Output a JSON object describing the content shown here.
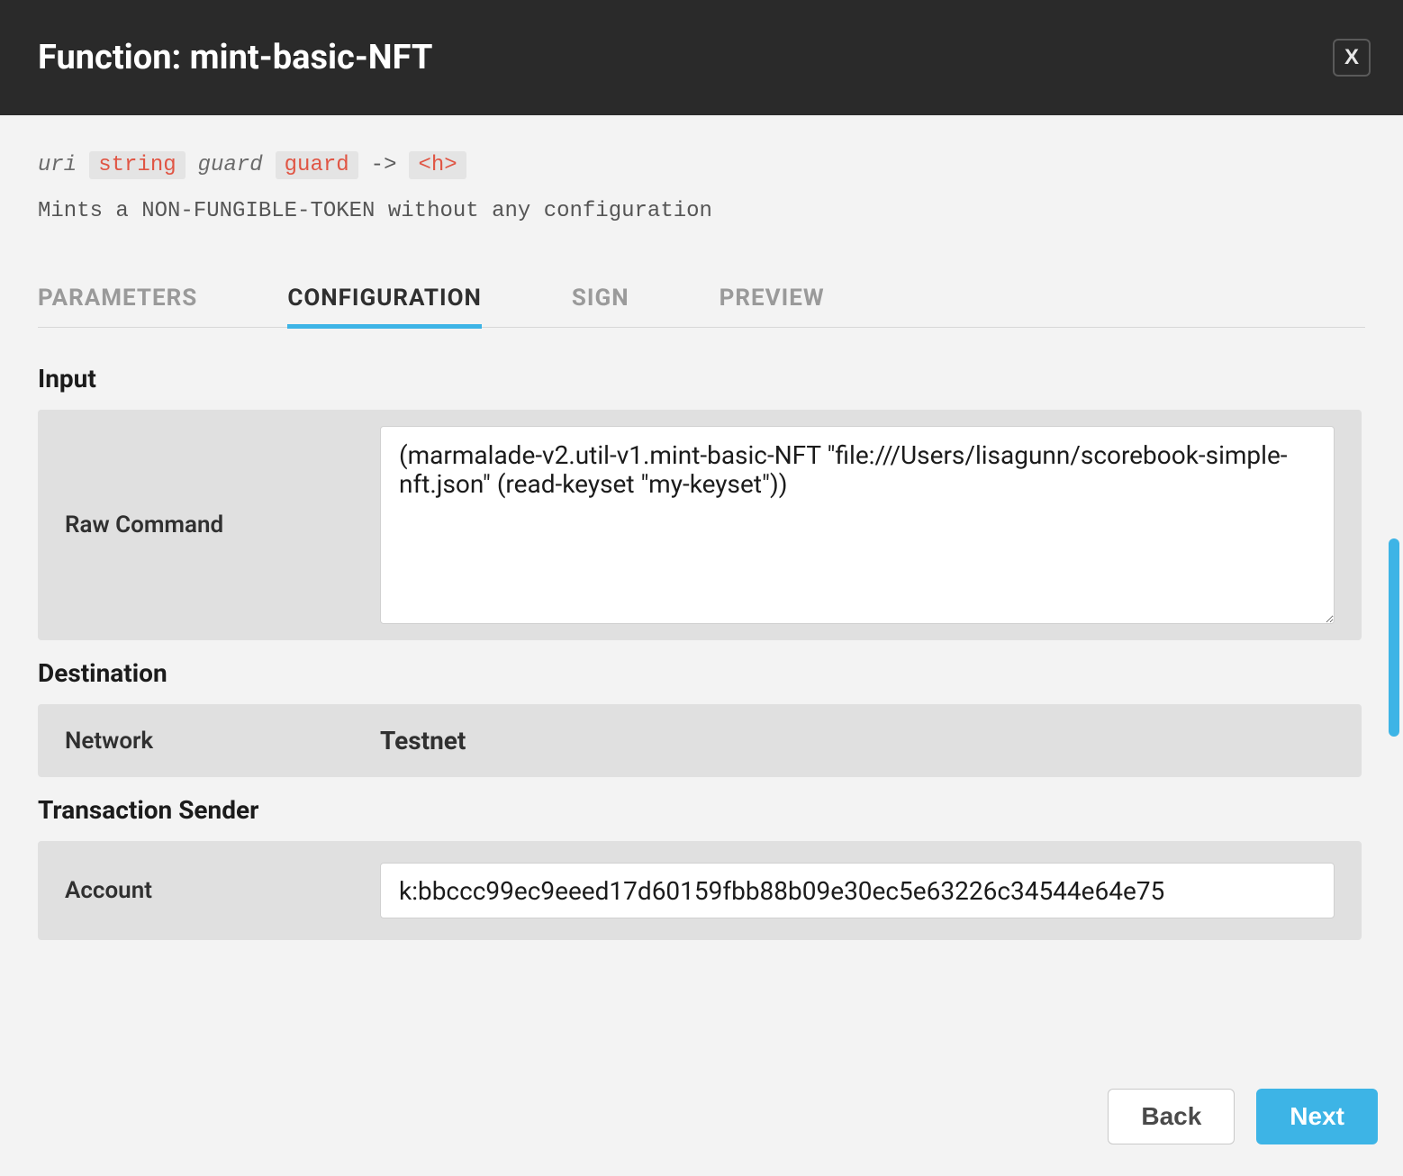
{
  "header": {
    "title": "Function: mint-basic-NFT",
    "close_label": "X"
  },
  "signature": {
    "params": [
      {
        "name": "uri",
        "type": "string"
      },
      {
        "name": "guard",
        "type": "guard"
      }
    ],
    "arrow": "->",
    "return_type": "<h>"
  },
  "description": "Mints a NON-FUNGIBLE-TOKEN without any configuration",
  "tabs": {
    "items": [
      {
        "id": "parameters",
        "label": "PARAMETERS",
        "active": false
      },
      {
        "id": "configuration",
        "label": "CONFIGURATION",
        "active": true
      },
      {
        "id": "sign",
        "label": "SIGN",
        "active": false
      },
      {
        "id": "preview",
        "label": "PREVIEW",
        "active": false
      }
    ]
  },
  "configuration": {
    "input": {
      "section_label": "Input",
      "raw_command_label": "Raw Command",
      "raw_command_value": "(marmalade-v2.util-v1.mint-basic-NFT \"file:///Users/lisagunn/scorebook-simple-nft.json\" (read-keyset \"my-keyset\"))"
    },
    "destination": {
      "section_label": "Destination",
      "network_label": "Network",
      "network_value": "Testnet"
    },
    "transaction_sender": {
      "section_label": "Transaction Sender",
      "account_label": "Account",
      "account_value": "k:bbccc99ec9eeed17d60159fbb88b09e30ec5e63226c34544e64e75"
    }
  },
  "footer": {
    "back_label": "Back",
    "next_label": "Next"
  }
}
